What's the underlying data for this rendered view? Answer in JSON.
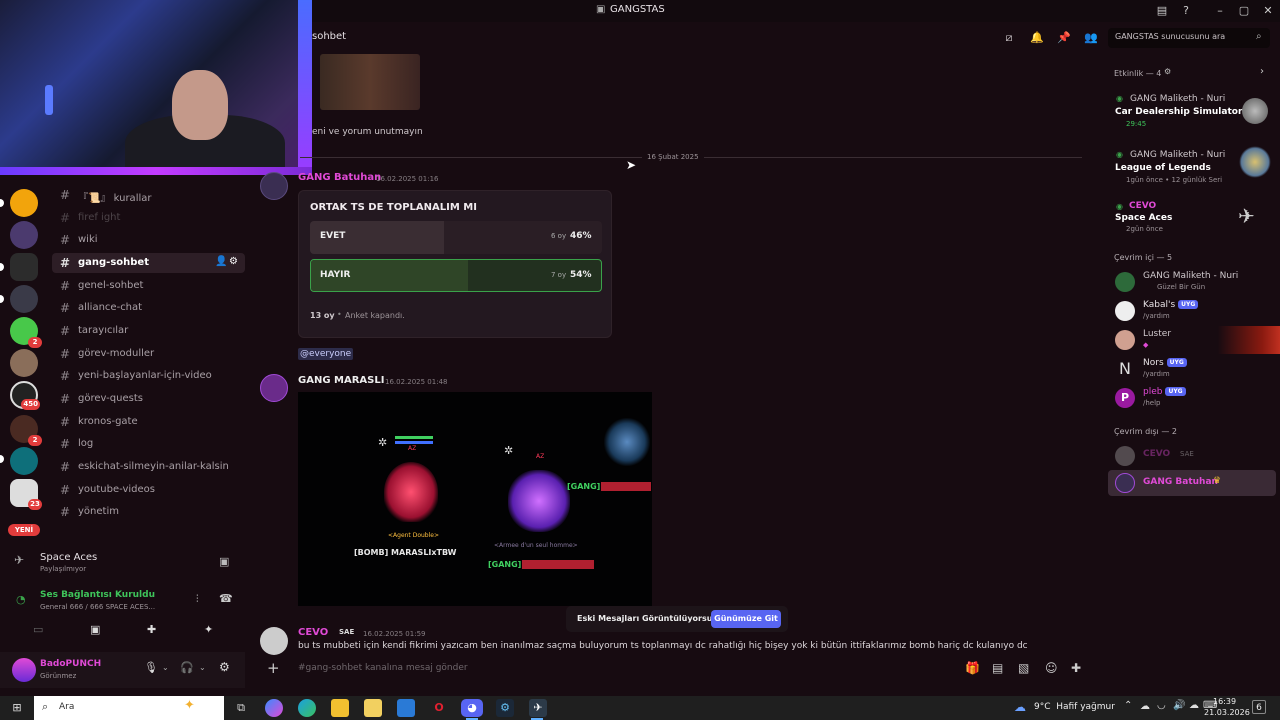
{
  "window": {
    "title": "GANGSTAS"
  },
  "header": {
    "channel_name": "sohbet"
  },
  "search": {
    "placeholder": "GANGSTAS sunucusunu ara"
  },
  "channels": [
    {
      "label": "『📜』 kurallar",
      "state": "normal"
    },
    {
      "label": "firef ight",
      "state": "muted"
    },
    {
      "label": "wiki",
      "state": "normal"
    },
    {
      "label": "gang-sohbet",
      "state": "active"
    },
    {
      "label": "genel-sohbet",
      "state": "normal"
    },
    {
      "label": "alliance-chat",
      "state": "normal"
    },
    {
      "label": "tarayıcılar",
      "state": "normal"
    },
    {
      "label": "görev-moduller",
      "state": "normal"
    },
    {
      "label": "yeni-başlayanlar-için-video",
      "state": "normal"
    },
    {
      "label": "görev-quests",
      "state": "normal"
    },
    {
      "label": "kronos-gate",
      "state": "normal"
    },
    {
      "label": "log",
      "state": "normal"
    },
    {
      "label": "eskichat-silmeyin-anilar-kalsin",
      "state": "normal"
    },
    {
      "label": "youtube-videos",
      "state": "normal"
    },
    {
      "label": "yönetim",
      "state": "normal"
    }
  ],
  "server_rail": {
    "badges": [
      "2",
      "2",
      "450",
      "2",
      "23"
    ],
    "new_label": "YENİ"
  },
  "activity": {
    "title": "Space Aces",
    "subtitle": "Paylaşılmıyor"
  },
  "voice": {
    "status": "Ses Bağlantısı Kuruldu",
    "channel": "General 666 / 666 SPACE ACES..."
  },
  "user": {
    "name": "BadoPUNCH",
    "status": "Görünmez"
  },
  "messages": {
    "prev_text": "eni ve yorum unutmayın",
    "date_divider": "16 Şubat 2025",
    "m1": {
      "author": "GANG Batuhan",
      "time": "16.02.2025 01:16"
    },
    "poll": {
      "question": "ORTAK TS DE TOPLANALIM MI",
      "options": [
        {
          "label": "EVET",
          "votes": "6 oy",
          "percent": "46%",
          "fraction": 0.46
        },
        {
          "label": "HAYIR",
          "votes": "7 oy",
          "percent": "54%",
          "fraction": 0.54
        }
      ],
      "total": "13 oy",
      "status": "Anket kapandı."
    },
    "mention": "@everyone",
    "m2": {
      "author": "GANG MARASLI",
      "time": "16.02.2025 01:48"
    },
    "game_labels": {
      "agent": "<Agent Double>",
      "bomb": "[BOMB] MARASLIxTBW",
      "gang": "[GANG]",
      "gang2": "[GANG]",
      "az1": "AZ",
      "az2": "AZ",
      "sub": "<Armee d'un seul homme>"
    },
    "m3": {
      "author": "CEVO",
      "tag": "SAE",
      "time": "16.02.2025 01:59",
      "text": "bu ts mubbeti için kendi fikrimi yazıcam ben inanılmaz saçma buluyorum ts toplanmayı dc rahatlığı hiç bişey yok ki bütün ittifaklarımız bomb hariç dc kulanıyo dc"
    }
  },
  "jump": {
    "text": "Eski Mesajları Görüntülüyorsun",
    "button": "Günümüze Git"
  },
  "composer": {
    "placeholder": "#gang-sohbet kanalına mesaj gönder"
  },
  "members": {
    "events_title": "Etkinlik — 4",
    "events": [
      {
        "name": "GANG Maliketh - Nuri",
        "game": "Car Dealership Simulator 2",
        "meta": "29:45"
      },
      {
        "name": "GANG Maliketh - Nuri",
        "game": "League of Legends",
        "meta": "1gün önce • 12 günlük Seri"
      },
      {
        "name": "CEVO",
        "game": "Space Aces",
        "meta": "2gün önce"
      }
    ],
    "online_title": "Çevrim içi — 5",
    "online": [
      {
        "name": "GANG Maliketh - Nuri",
        "sub": "Güzel Bir Gün",
        "badge": ""
      },
      {
        "name": "Kabal's",
        "sub": "/yardım",
        "badge": "UYG"
      },
      {
        "name": "Luster",
        "sub": "",
        "badge": ""
      },
      {
        "name": "Nors",
        "sub": "/yardım",
        "badge": "UYG"
      },
      {
        "name": "pleb",
        "sub": "/help",
        "badge": "UYG"
      }
    ],
    "offline_title": "Çevrim dışı — 2",
    "offline": [
      {
        "name": "CEVO",
        "tag": "SAE"
      },
      {
        "name": "GANG Batuhan",
        "tag": ""
      }
    ]
  },
  "taskbar": {
    "search_placeholder": "Ara",
    "weather": "9°C  Hafif yağmur",
    "time": "16:39",
    "date": "21.03.2026",
    "notif": "6"
  },
  "colors": {
    "accent": "#5865f2",
    "poll_selected": "#3aa24a",
    "name_pink": "#e04ad6",
    "badge_red": "#e23c3c"
  }
}
